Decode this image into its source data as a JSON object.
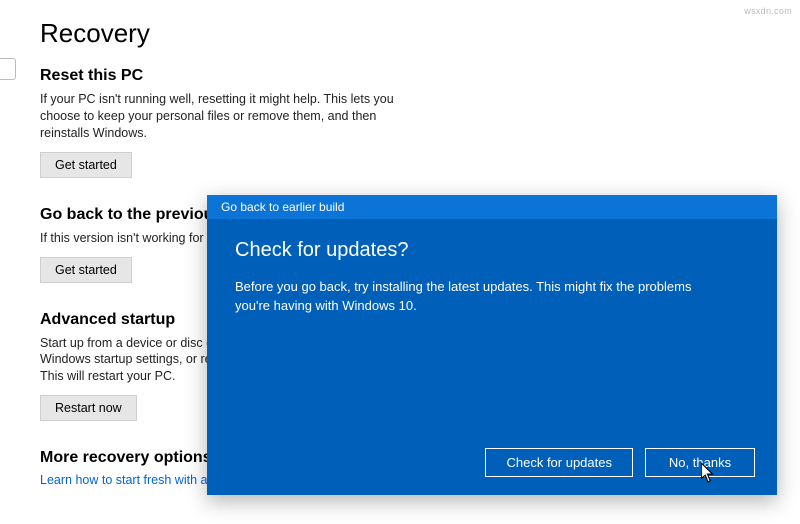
{
  "page": {
    "title": "Recovery"
  },
  "sections": {
    "reset": {
      "heading": "Reset this PC",
      "desc": "If your PC isn't running well, resetting it might help. This lets you choose to keep your personal files or remove them, and then reinstalls Windows.",
      "button": "Get started"
    },
    "goback": {
      "heading": "Go back to the previous",
      "desc": "If this version isn't working for",
      "button": "Get started"
    },
    "advanced": {
      "heading": "Advanced startup",
      "desc": "Start up from a device or disc (\nWindows startup settings, or re\nThis will restart your PC.",
      "button": "Restart now"
    },
    "more": {
      "heading": "More recovery options",
      "link": "Learn how to start fresh with a clean installation of Windows"
    }
  },
  "dialog": {
    "titlebar": "Go back to earlier build",
    "heading": "Check for updates?",
    "text": "Before you go back, try installing the latest updates. This might fix the problems you're having with Windows 10.",
    "check_btn": "Check for updates",
    "no_btn": "No, thanks"
  },
  "watermark": "wsxdn.com"
}
